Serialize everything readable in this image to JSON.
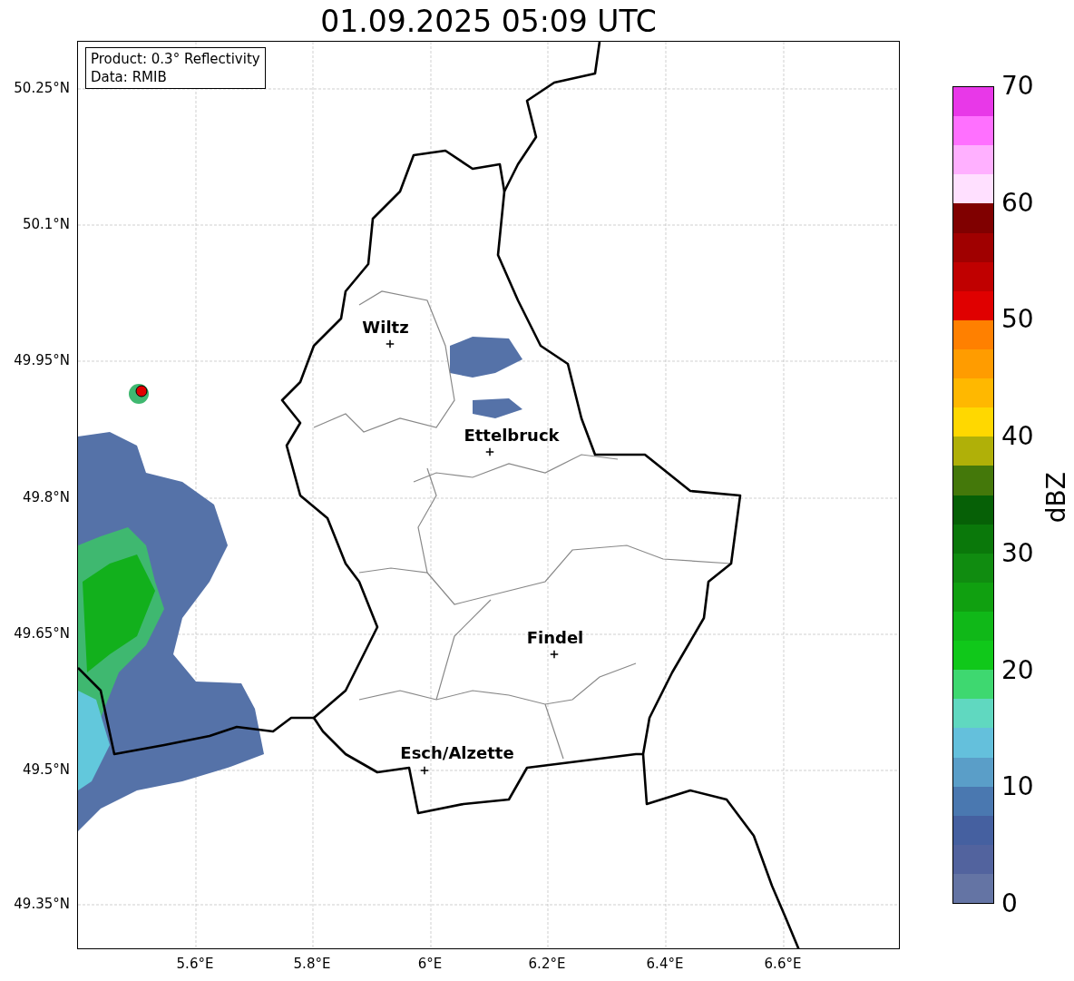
{
  "title": "01.09.2025 05:09 UTC",
  "info_box": [
    "Product: 0.3° Reflectivity",
    "Data: RMIB"
  ],
  "map": {
    "cities": [
      {
        "name": "Wiltz"
      },
      {
        "name": "Ettelbruck"
      },
      {
        "name": "Findel"
      },
      {
        "name": "Esch/Alzette"
      }
    ]
  },
  "y_ticks": [
    "50.25°N",
    "50.1°N",
    "49.95°N",
    "49.8°N",
    "49.65°N",
    "49.5°N",
    "49.35°N"
  ],
  "x_ticks": [
    "5.6°E",
    "5.8°E",
    "6°E",
    "6.2°E",
    "6.4°E",
    "6.6°E"
  ],
  "colorbar": {
    "label": "dBZ",
    "ticks": [
      "70",
      "60",
      "50",
      "40",
      "30",
      "20",
      "10",
      "0"
    ],
    "bands": [
      {
        "color": "#e838e8"
      },
      {
        "color": "#ff70ff"
      },
      {
        "color": "#ffb0ff"
      },
      {
        "color": "#ffe0ff"
      },
      {
        "color": "#800000"
      },
      {
        "color": "#a00000"
      },
      {
        "color": "#c00000"
      },
      {
        "color": "#e00000"
      },
      {
        "color": "#ff8000"
      },
      {
        "color": "#ff9c00"
      },
      {
        "color": "#ffb800"
      },
      {
        "color": "#ffd800"
      },
      {
        "color": "#b0b008"
      },
      {
        "color": "#44780a"
      },
      {
        "color": "#066006"
      },
      {
        "color": "#0a780a"
      },
      {
        "color": "#108c10"
      },
      {
        "color": "#10a010"
      },
      {
        "color": "#10b818"
      },
      {
        "color": "#10c81a"
      },
      {
        "color": "#3ed870"
      },
      {
        "color": "#60d8c0"
      },
      {
        "color": "#64c0dc"
      },
      {
        "color": "#5a9ec8"
      },
      {
        "color": "#4a78b0"
      },
      {
        "color": "#4560a0"
      },
      {
        "color": "#52639e"
      },
      {
        "color": "#6474a4"
      }
    ]
  }
}
